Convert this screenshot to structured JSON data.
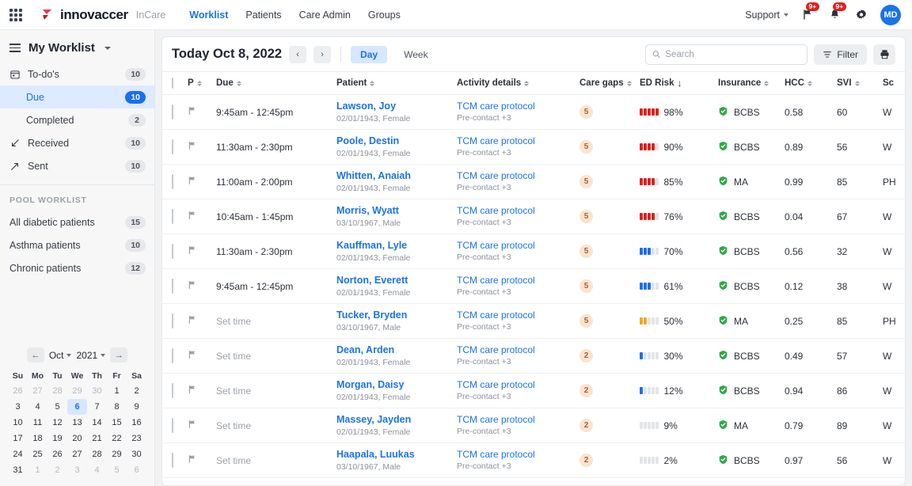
{
  "topnav": {
    "apps_icon": "grid-apps-icon",
    "brand": "innovaccer",
    "product": "InCare",
    "links": [
      {
        "label": "Worklist",
        "active": true
      },
      {
        "label": "Patients",
        "active": false
      },
      {
        "label": "Care Admin",
        "active": false
      },
      {
        "label": "Groups",
        "active": false
      }
    ],
    "support_label": "Support",
    "flag_badge": "9+",
    "bell_badge": "9+",
    "settings_icon": "gear-icon",
    "avatar_initials": "MD"
  },
  "sidebar": {
    "title": "My Worklist",
    "items": [
      {
        "label": "To-do's",
        "count": "10",
        "icon": "calendar-icon",
        "active": false,
        "indent": false
      },
      {
        "label": "Due",
        "count": "10",
        "icon": "",
        "active": true,
        "indent": true
      },
      {
        "label": "Completed",
        "count": "2",
        "icon": "",
        "active": false,
        "indent": true
      },
      {
        "label": "Received",
        "count": "10",
        "icon": "arrow-down-left-icon",
        "active": false,
        "indent": false
      },
      {
        "label": "Sent",
        "count": "10",
        "icon": "arrow-up-right-icon",
        "active": false,
        "indent": false
      }
    ],
    "pool_title": "POOL WORKLIST",
    "pool_items": [
      {
        "label": "All diabetic patients",
        "count": "15"
      },
      {
        "label": "Asthma patients",
        "count": "10"
      },
      {
        "label": "Chronic patients",
        "count": "12"
      }
    ]
  },
  "calendar": {
    "month": "Oct",
    "year": "2021",
    "prev_icon": "arrow-left-icon",
    "next_icon": "arrow-right-icon",
    "dow": [
      "Su",
      "Mo",
      "Tu",
      "We",
      "Th",
      "Fr",
      "Sa"
    ],
    "selected_day": "6",
    "weeks": [
      [
        {
          "d": "26",
          "m": true
        },
        {
          "d": "27",
          "m": true
        },
        {
          "d": "28",
          "m": true
        },
        {
          "d": "29",
          "m": true
        },
        {
          "d": "30",
          "m": true
        },
        {
          "d": "1",
          "m": false
        },
        {
          "d": "2",
          "m": false
        }
      ],
      [
        {
          "d": "3",
          "m": false
        },
        {
          "d": "4",
          "m": false
        },
        {
          "d": "5",
          "m": false
        },
        {
          "d": "6",
          "m": false,
          "sel": true
        },
        {
          "d": "7",
          "m": false
        },
        {
          "d": "8",
          "m": false
        },
        {
          "d": "9",
          "m": false
        }
      ],
      [
        {
          "d": "10",
          "m": false
        },
        {
          "d": "11",
          "m": false
        },
        {
          "d": "12",
          "m": false
        },
        {
          "d": "13",
          "m": false
        },
        {
          "d": "14",
          "m": false
        },
        {
          "d": "15",
          "m": false
        },
        {
          "d": "16",
          "m": false
        }
      ],
      [
        {
          "d": "17",
          "m": false
        },
        {
          "d": "18",
          "m": false
        },
        {
          "d": "19",
          "m": false
        },
        {
          "d": "20",
          "m": false
        },
        {
          "d": "21",
          "m": false
        },
        {
          "d": "22",
          "m": false
        },
        {
          "d": "23",
          "m": false
        }
      ],
      [
        {
          "d": "24",
          "m": false
        },
        {
          "d": "25",
          "m": false
        },
        {
          "d": "26",
          "m": false
        },
        {
          "d": "27",
          "m": false
        },
        {
          "d": "28",
          "m": false
        },
        {
          "d": "29",
          "m": false
        },
        {
          "d": "30",
          "m": false
        }
      ],
      [
        {
          "d": "31",
          "m": false
        },
        {
          "d": "1",
          "m": true
        },
        {
          "d": "2",
          "m": true
        },
        {
          "d": "3",
          "m": true
        },
        {
          "d": "4",
          "m": true
        },
        {
          "d": "5",
          "m": true
        },
        {
          "d": "6",
          "m": true
        }
      ]
    ]
  },
  "toolbar": {
    "today_label": "Today Oct 8, 2022",
    "prev_icon": "chevron-left-icon",
    "next_icon": "chevron-right-icon",
    "views": [
      {
        "label": "Day",
        "active": true
      },
      {
        "label": "Week",
        "active": false
      }
    ],
    "search_placeholder": "Search",
    "search_value": "",
    "search_icon": "search-icon",
    "filter_label": "Filter",
    "filter_icon": "filter-icon",
    "print_icon": "printer-icon"
  },
  "table": {
    "columns": [
      {
        "label": "P",
        "sort": "both"
      },
      {
        "label": "Due",
        "sort": "both"
      },
      {
        "label": "Patient",
        "sort": "both"
      },
      {
        "label": "Activity details",
        "sort": "both"
      },
      {
        "label": "Care gaps",
        "sort": "both"
      },
      {
        "label": "ED Risk",
        "sort": "desc"
      },
      {
        "label": "Insurance",
        "sort": "both"
      },
      {
        "label": "HCC",
        "sort": "both"
      },
      {
        "label": "SVI",
        "sort": "both"
      },
      {
        "label": "Sc",
        "sort": "none"
      }
    ],
    "set_time_label": "Set time",
    "rows": [
      {
        "due": "9:45am - 12:45pm",
        "set_time": false,
        "patient": "Lawson, Joy",
        "meta": "02/01/1943, Female",
        "activity": "TCM care protocol",
        "activity_sub": "Pre-contact +3",
        "gaps": "5",
        "risk": "98%",
        "risk_filled": 5,
        "risk_color": "#e02020",
        "insurance": "BCBS",
        "hcc": "0.58",
        "svi": "60",
        "sc": "W"
      },
      {
        "due": "11:30am - 2:30pm",
        "set_time": false,
        "patient": "Poole, Destin",
        "meta": "02/01/1943, Female",
        "activity": "TCM care protocol",
        "activity_sub": "Pre-contact +3",
        "gaps": "5",
        "risk": "90%",
        "risk_filled": 4,
        "risk_color": "#e02020",
        "insurance": "BCBS",
        "hcc": "0.89",
        "svi": "56",
        "sc": "W"
      },
      {
        "due": "11:00am - 2:00pm",
        "set_time": false,
        "patient": "Whitten, Anaiah",
        "meta": "02/01/1943, Female",
        "activity": "TCM care protocol",
        "activity_sub": "Pre-contact +3",
        "gaps": "5",
        "risk": "85%",
        "risk_filled": 4,
        "risk_color": "#e02020",
        "insurance": "MA",
        "hcc": "0.99",
        "svi": "85",
        "sc": "PH"
      },
      {
        "due": "10:45am - 1:45pm",
        "set_time": false,
        "patient": "Morris, Wyatt",
        "meta": "03/10/1967, Male",
        "activity": "TCM care protocol",
        "activity_sub": "Pre-contact +3",
        "gaps": "5",
        "risk": "76%",
        "risk_filled": 4,
        "risk_color": "#e02020",
        "insurance": "BCBS",
        "hcc": "0.04",
        "svi": "67",
        "sc": "W"
      },
      {
        "due": "11:30am - 2:30pm",
        "set_time": false,
        "patient": "Kauffman, Lyle",
        "meta": "02/01/1943, Female",
        "activity": "TCM care protocol",
        "activity_sub": "Pre-contact +3",
        "gaps": "5",
        "risk": "70%",
        "risk_filled": 3,
        "risk_color": "#1a6ef5",
        "insurance": "BCBS",
        "hcc": "0.56",
        "svi": "32",
        "sc": "W"
      },
      {
        "due": "9:45am - 12:45pm",
        "set_time": false,
        "patient": "Norton, Everett",
        "meta": "02/01/1943, Female",
        "activity": "TCM care protocol",
        "activity_sub": "Pre-contact +3",
        "gaps": "5",
        "risk": "61%",
        "risk_filled": 3,
        "risk_color": "#1a6ef5",
        "insurance": "BCBS",
        "hcc": "0.12",
        "svi": "38",
        "sc": "W"
      },
      {
        "due": "Set time",
        "set_time": true,
        "patient": "Tucker, Bryden",
        "meta": "03/10/1967, Male",
        "activity": "TCM care protocol",
        "activity_sub": "Pre-contact +3",
        "gaps": "5",
        "risk": "50%",
        "risk_filled": 2,
        "risk_color": "#f5a623",
        "insurance": "MA",
        "hcc": "0.25",
        "svi": "85",
        "sc": "PH"
      },
      {
        "due": "Set time",
        "set_time": true,
        "patient": "Dean, Arden",
        "meta": "02/01/1943, Female",
        "activity": "TCM care protocol",
        "activity_sub": "Pre-contact +3",
        "gaps": "2",
        "risk": "30%",
        "risk_filled": 1,
        "risk_color": "#1a6ef5",
        "insurance": "BCBS",
        "hcc": "0.49",
        "svi": "57",
        "sc": "W"
      },
      {
        "due": "Set time",
        "set_time": true,
        "patient": "Morgan, Daisy",
        "meta": "02/01/1943, Female",
        "activity": "TCM care protocol",
        "activity_sub": "Pre-contact +3",
        "gaps": "2",
        "risk": "12%",
        "risk_filled": 1,
        "risk_color": "#1a6ef5",
        "insurance": "BCBS",
        "hcc": "0.94",
        "svi": "86",
        "sc": "W"
      },
      {
        "due": "Set time",
        "set_time": true,
        "patient": "Massey, Jayden",
        "meta": "02/01/1943, Female",
        "activity": "TCM care protocol",
        "activity_sub": "Pre-contact +3",
        "gaps": "2",
        "risk": "9%",
        "risk_filled": 0,
        "risk_color": "#e2e5e8",
        "insurance": "MA",
        "hcc": "0.79",
        "svi": "89",
        "sc": "W"
      },
      {
        "due": "Set time",
        "set_time": true,
        "patient": "Haapala, Luukas",
        "meta": "03/10/1967, Male",
        "activity": "TCM care protocol",
        "activity_sub": "Pre-contact +3",
        "gaps": "2",
        "risk": "2%",
        "risk_filled": 0,
        "risk_color": "#e2e5e8",
        "insurance": "BCBS",
        "hcc": "0.97",
        "svi": "56",
        "sc": "W"
      }
    ]
  },
  "colors": {
    "accent": "#1a73e8",
    "risk_high": "#e02020",
    "risk_mid": "#1a6ef5",
    "risk_low": "#f5a623",
    "gap_badge_bg": "#fbe4cd",
    "gap_badge_fg": "#a0643a",
    "insurance_ok": "#2eaa45",
    "badge_red": "#e02020"
  }
}
